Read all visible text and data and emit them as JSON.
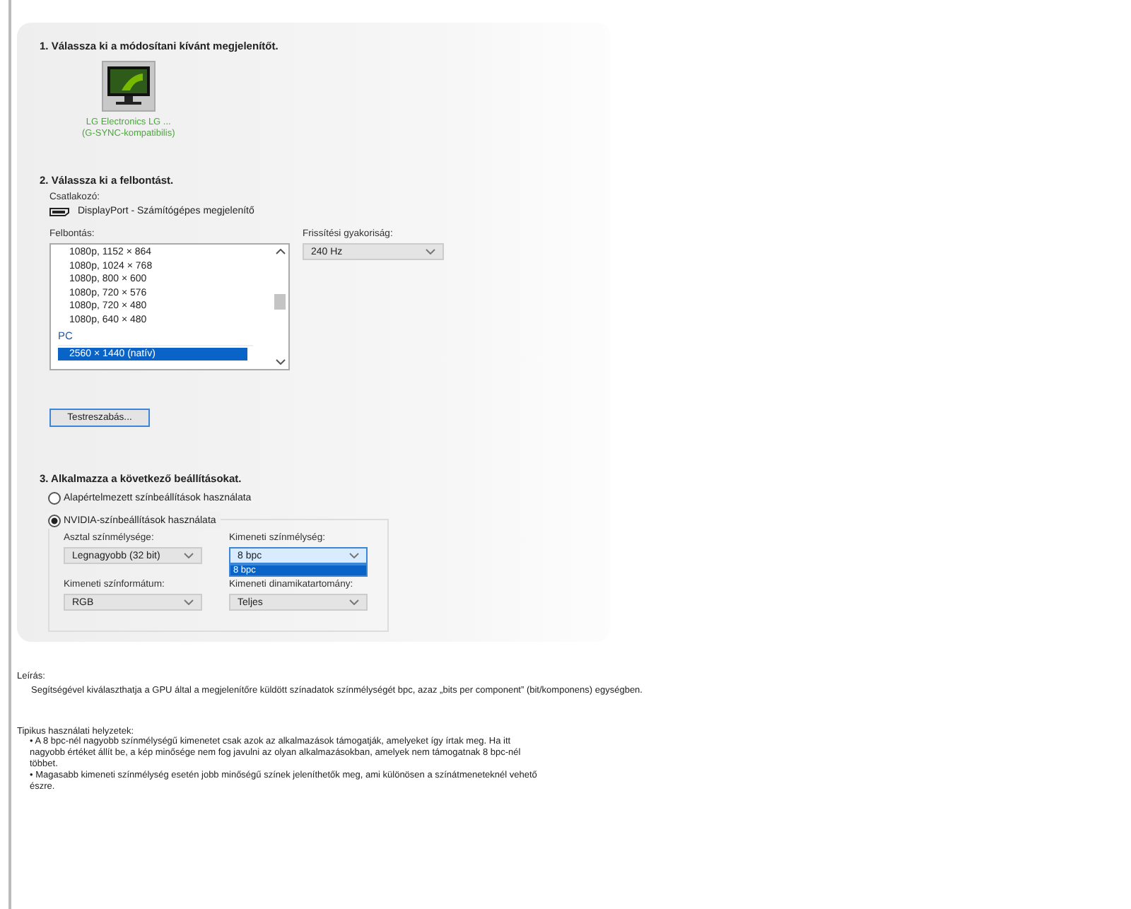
{
  "section1": {
    "heading": "1. Válassza ki a módosítani kívánt megjelenítőt.",
    "displays": [
      {
        "name": "LG Electronics LG ...",
        "note": "(G-SYNC-kompatibilis)",
        "selected": true
      }
    ]
  },
  "section2": {
    "heading": "2. Válassza ki a felbontást.",
    "connector_label": "Csatlakozó:",
    "connector": "DisplayPort - Számítógépes megjelenítő",
    "resolution_label": "Felbontás:",
    "resolutions": [
      {
        "kind": "item",
        "text": "1080p, 1152 × 864",
        "selected": false
      },
      {
        "kind": "item",
        "text": "1080p, 1024 × 768",
        "selected": false
      },
      {
        "kind": "item",
        "text": "1080p, 800 × 600",
        "selected": false
      },
      {
        "kind": "item",
        "text": "1080p, 720 × 576",
        "selected": false
      },
      {
        "kind": "item",
        "text": "1080p, 720 × 480",
        "selected": false
      },
      {
        "kind": "item",
        "text": "1080p, 640 × 480",
        "selected": false
      },
      {
        "kind": "header",
        "text": "PC"
      },
      {
        "kind": "item",
        "text": "2560 × 1440 (natív)",
        "selected": true
      }
    ],
    "refresh_label": "Frissítési gyakoriság:",
    "refresh_value": "240 Hz",
    "customize_button": "Testreszabás..."
  },
  "section3": {
    "heading": "3. Alkalmazza a következő beállításokat.",
    "radios": [
      {
        "label": "Alapértelmezett színbeállítások használata",
        "selected": false
      },
      {
        "label": "NVIDIA-színbeállítások használata",
        "selected": true
      }
    ],
    "fields": [
      {
        "label": "Asztal színmélysége:",
        "value": "Legnagyobb (32 bit)",
        "open": false
      },
      {
        "label": "Kimeneti színmélység:",
        "value": "8 bpc",
        "open": true,
        "options": [
          "8 bpc"
        ]
      },
      {
        "label": "Kimeneti színformátum:",
        "value": "RGB",
        "open": false
      },
      {
        "label": "Kimeneti dinamikatartomány:",
        "value": "Teljes",
        "open": false
      }
    ]
  },
  "description": {
    "label": "Leírás:",
    "text": "Segítségével kiválaszthatja a GPU által a megjelenítőre küldött színadatok színmélységét bpc, azaz „bits per component” (bit/komponens) egységben."
  },
  "usage": {
    "label": "Tipikus használati helyzetek:",
    "bullets": [
      "• A 8 bpc-nél nagyobb színmélységű kimenetet csak azok az alkalmazások támogatják, amelyeket így írtak meg. Ha itt nagyobb értéket állít be, a kép minősége nem fog javulni az olyan alkalmazásokban, amelyek nem támogatnak 8 bpc-nél többet.",
      "• Magasabb kimeneti színmélység esetén jobb minőségű színek jeleníthetők meg, ami különösen a színátmeneteknél vehető észre."
    ]
  }
}
